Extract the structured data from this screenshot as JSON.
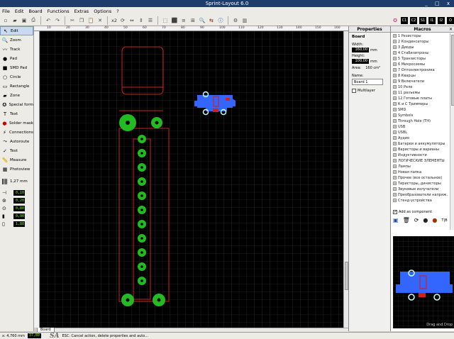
{
  "window": {
    "title": "Sprint-Layout 6.0",
    "controls": "_ □ x"
  },
  "menu": [
    "File",
    "Edit",
    "Board",
    "Functions",
    "Extras",
    "Options",
    "?"
  ],
  "toolbar": {
    "zoom_text": "x2"
  },
  "tools": [
    {
      "label": "Edit",
      "icon": "cursor-icon",
      "glyph": "↖"
    },
    {
      "label": "Zoom",
      "icon": "zoom-icon",
      "glyph": "🔍"
    },
    {
      "label": "Track",
      "icon": "track-icon",
      "glyph": "〰"
    },
    {
      "label": "Pad",
      "icon": "pad-icon",
      "glyph": "●"
    },
    {
      "label": "SMD Pad",
      "icon": "smd-pad-icon",
      "glyph": "■"
    },
    {
      "label": "Circle",
      "icon": "circle-icon",
      "glyph": "○"
    },
    {
      "label": "Rectangle",
      "icon": "rectangle-icon",
      "glyph": "▭"
    },
    {
      "label": "Zone",
      "icon": "zone-icon",
      "glyph": "▰"
    },
    {
      "label": "Special form",
      "icon": "special-form-icon",
      "glyph": "✪"
    },
    {
      "label": "Text",
      "icon": "text-icon",
      "glyph": "T"
    },
    {
      "label": "Solder mask",
      "icon": "solder-mask-icon",
      "glyph": "●"
    },
    {
      "label": "Connections",
      "icon": "connections-icon",
      "glyph": "⚡"
    },
    {
      "label": "Autoroute",
      "icon": "autoroute-icon",
      "glyph": "⤳"
    },
    {
      "label": "Test",
      "icon": "test-icon",
      "glyph": "✓"
    },
    {
      "label": "Measure",
      "icon": "measure-icon",
      "glyph": "📏"
    },
    {
      "label": "Photoview",
      "icon": "photoview-icon",
      "glyph": "▦"
    }
  ],
  "grid": {
    "value": "1,27 mm"
  },
  "params": [
    {
      "icon": "track-width-icon",
      "glyph": "⊣",
      "value": "0,10"
    },
    {
      "icon": "pad-outer-icon",
      "glyph": "⊚",
      "value": "0,20"
    },
    {
      "icon": "pad-inner-icon",
      "glyph": "⊙",
      "value": "0,80"
    },
    {
      "icon": "smd-size-icon",
      "glyph": "▮",
      "value": "0,90"
    },
    {
      "icon": "smd-size2-icon",
      "glyph": "▯",
      "value": "1,80"
    }
  ],
  "ruler": {
    "top_ticks": [
      "10",
      "20",
      "30",
      "40",
      "50",
      "60",
      "70",
      "80",
      "90",
      "100",
      "110",
      "120",
      "130",
      "140",
      "150",
      "160"
    ]
  },
  "board_tab": "Board 1",
  "properties": {
    "title": "Properties",
    "section": "Board",
    "width_label": "Width:",
    "width_value": "160,00",
    "width_unit": "mm",
    "height_label": "Height:",
    "height_value": "100,00",
    "height_unit": "mm",
    "area_label": "Area:",
    "area_value": "160 cm²",
    "name_label": "Name:",
    "name_value": "Board 1",
    "multilayer_label": "Multilayer"
  },
  "macros": {
    "title": "Macros",
    "items": [
      "1 Резисторы",
      "2 Конденсаторы",
      "3 Диоды",
      "4 Стабилитроны",
      "5 Транзисторы",
      "6 Микросхемы",
      "7 Оптоэлектроника",
      "8 Кварцы",
      "9 Включатели",
      "10 Реле",
      "11 разъемы",
      "12 Готовые платы",
      "К и С Триммеры",
      "SMD",
      "Symbols",
      "Through Hole (TH)",
      "USB",
      "USBL",
      "Аудио",
      "Батареи и аккумуляторы",
      "Варисторы и варианы",
      "Индуктивности",
      "ЛОГИЧЕСКИЕ ЭЛЕМЕНТЫ",
      "Лампы",
      "Новая папка",
      "Прочее (все остальное)",
      "Тиристоры, динисторы",
      "Звуковые излучатели",
      "Преобразователи напряж.",
      "Стенд-устройства"
    ],
    "add_component_label": "Add as component",
    "preview_label": "Drag and Drop"
  },
  "status": {
    "coords": "x: 4,760 mm",
    "y_value": "37,80",
    "logo": "SA",
    "hint": "ESC: Cancel action, delete properties and auto..."
  },
  "colors": {
    "canvas": "#000000",
    "pad": "#22bb22",
    "outline": "#cc2222",
    "component": "#3366ff"
  }
}
